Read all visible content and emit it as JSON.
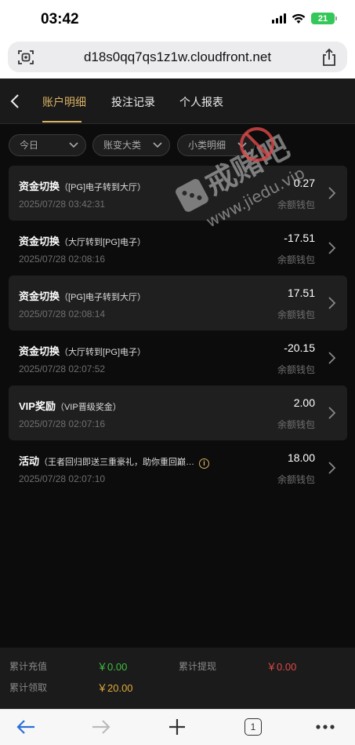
{
  "status_bar": {
    "time": "03:42",
    "battery": "21"
  },
  "browser": {
    "url": "d18s0qq7qs1z1w.cloudfront.net",
    "tab_count": "1"
  },
  "tabs": [
    {
      "label": "账户明细",
      "active": true
    },
    {
      "label": "投注记录",
      "active": false
    },
    {
      "label": "个人报表",
      "active": false
    }
  ],
  "filters": [
    {
      "label": "今日"
    },
    {
      "label": "账变大类"
    },
    {
      "label": "小类明细"
    }
  ],
  "records": [
    {
      "title": "资金切换",
      "desc": "（[PG]电子转到大厅）",
      "time": "2025/07/28 03:42:31",
      "amount": "0.27",
      "wallet": "余额钱包"
    },
    {
      "title": "资金切换",
      "desc": "（大厅转到[PG]电子）",
      "time": "2025/07/28 02:08:16",
      "amount": "-17.51",
      "wallet": "余额钱包"
    },
    {
      "title": "资金切换",
      "desc": "（[PG]电子转到大厅）",
      "time": "2025/07/28 02:08:14",
      "amount": "17.51",
      "wallet": "余额钱包"
    },
    {
      "title": "资金切换",
      "desc": "（大厅转到[PG]电子）",
      "time": "2025/07/28 02:07:52",
      "amount": "-20.15",
      "wallet": "余额钱包"
    },
    {
      "title": "VIP奖励",
      "desc": "（VIP晋级奖金）",
      "time": "2025/07/28 02:07:16",
      "amount": "2.00",
      "wallet": "余额钱包"
    },
    {
      "title": "活动",
      "desc": "（王者回归即送三重豪礼，助你重回巅…",
      "time": "2025/07/28 02:07:10",
      "amount": "18.00",
      "wallet": "余额钱包"
    }
  ],
  "summary": {
    "deposit_label": "累计充值",
    "deposit_value": "￥0.00",
    "withdraw_label": "累计提现",
    "withdraw_value": "￥0.00",
    "claim_label": "累计领取",
    "claim_value": "￥20.00"
  },
  "watermark": {
    "line1": "戒赌吧",
    "line2": "www.jiedu.vip"
  },
  "colors": {
    "accent": "#d9b263",
    "green": "#3fbf3f",
    "red": "#e04848",
    "gold": "#e0a93a"
  }
}
